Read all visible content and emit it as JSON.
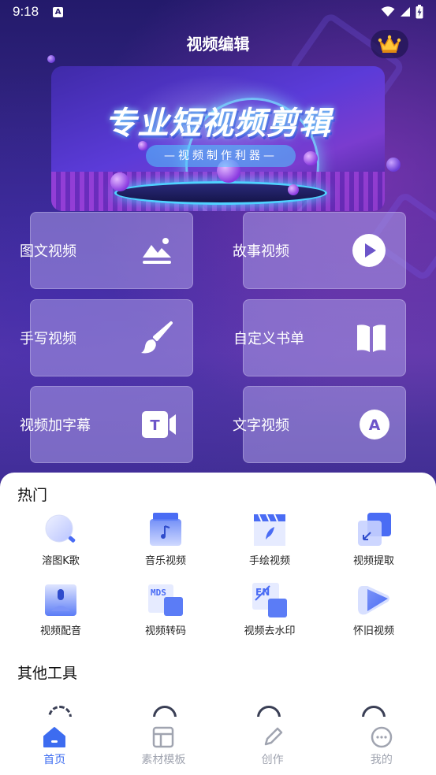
{
  "status_bar": {
    "time": "9:18",
    "badge": "A"
  },
  "header": {
    "title": "视频编辑"
  },
  "banner": {
    "title": "专业短视频剪辑",
    "subtitle": "—视频制作利器—"
  },
  "feature_cards": [
    {
      "label": "图文视频",
      "icon": "image-mountain-icon"
    },
    {
      "label": "故事视频",
      "icon": "play-circle-icon"
    },
    {
      "label": "手写视频",
      "icon": "paintbrush-icon"
    },
    {
      "label": "自定义书单",
      "icon": "open-book-icon"
    },
    {
      "label": "视频加字幕",
      "icon": "subtitle-t-icon"
    },
    {
      "label": "文字视频",
      "icon": "letter-a-icon"
    }
  ],
  "hot": {
    "title": "热门",
    "items": [
      {
        "label": "溶图K歌",
        "icon": "magnifier-blend-icon"
      },
      {
        "label": "音乐视频",
        "icon": "music-note-icon"
      },
      {
        "label": "手绘视频",
        "icon": "clapper-feather-icon"
      },
      {
        "label": "视频提取",
        "icon": "extract-arrow-icon"
      },
      {
        "label": "视频配音",
        "icon": "microphone-icon"
      },
      {
        "label": "视频转码",
        "icon": "mp4-transcode-icon"
      },
      {
        "label": "视频去水印",
        "icon": "remove-watermark-icon"
      },
      {
        "label": "怀旧视频",
        "icon": "retro-play-icon"
      }
    ]
  },
  "other": {
    "title": "其他工具"
  },
  "tabbar": [
    {
      "label": "首页",
      "icon": "home-icon",
      "active": true
    },
    {
      "label": "素材模板",
      "icon": "template-icon",
      "active": false
    },
    {
      "label": "创作",
      "icon": "pencil-icon",
      "active": false
    },
    {
      "label": "我的",
      "icon": "profile-dots-icon",
      "active": false
    }
  ],
  "colors": {
    "accent": "#3d6cf0",
    "icon_blue": "#4a6cf4",
    "inactive": "#a0a4b0"
  }
}
